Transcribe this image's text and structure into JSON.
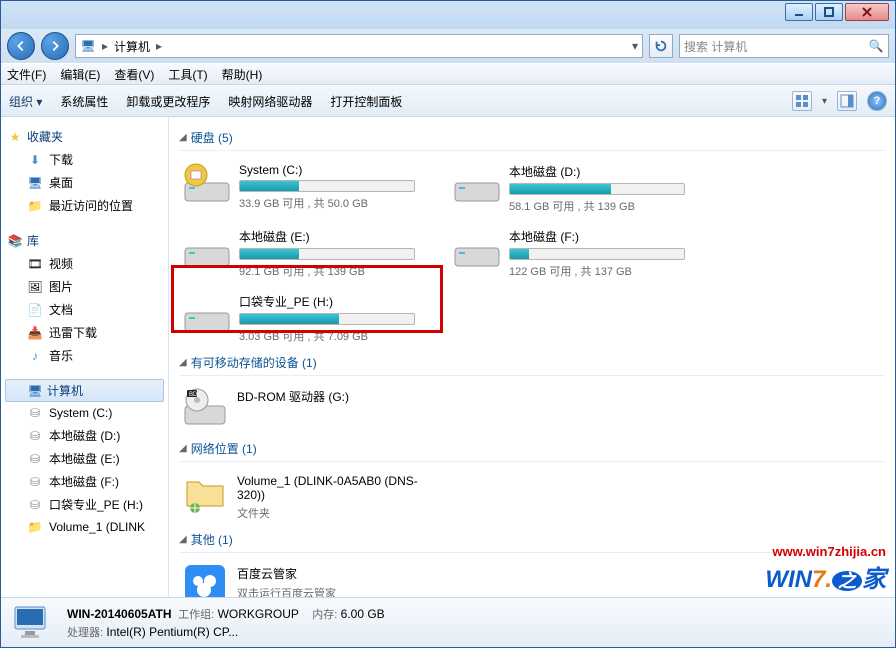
{
  "titlebar": {
    "minimize": "_",
    "maximize": "☐",
    "close": "×"
  },
  "nav": {
    "breadcrumb_icon": "computer",
    "breadcrumb": "计算机",
    "search_placeholder": "搜索 计算机"
  },
  "menu": {
    "file": "文件(F)",
    "edit": "编辑(E)",
    "view": "查看(V)",
    "tools": "工具(T)",
    "help": "帮助(H)"
  },
  "toolbar": {
    "organize": "组织 ▾",
    "sysprop": "系统属性",
    "uninstall": "卸载或更改程序",
    "mapnet": "映射网络驱动器",
    "ctrlpanel": "打开控制面板"
  },
  "side": {
    "favorites": "收藏夹",
    "fav_items": [
      "下载",
      "桌面",
      "最近访问的位置"
    ],
    "libraries": "库",
    "lib_items": [
      "视频",
      "图片",
      "文档",
      "迅雷下载",
      "音乐"
    ],
    "computer": "计算机",
    "comp_items": [
      "System (C:)",
      "本地磁盘 (D:)",
      "本地磁盘 (E:)",
      "本地磁盘 (F:)",
      "口袋专业_PE (H:)",
      "Volume_1 (DLINK"
    ]
  },
  "main": {
    "hdd_header": "硬盘 (5)",
    "removable_header": "有可移动存储的设备 (1)",
    "network_header": "网络位置 (1)",
    "other_header": "其他 (1)",
    "drives": [
      {
        "name": "System (C:)",
        "free": "33.9 GB 可用 , 共 50.0 GB",
        "fill": 34
      },
      {
        "name": "本地磁盘 (D:)",
        "free": "58.1 GB 可用 , 共 139 GB",
        "fill": 58
      },
      {
        "name": "本地磁盘 (E:)",
        "free": "92.1 GB 可用 , 共 139 GB",
        "fill": 34
      },
      {
        "name": "本地磁盘 (F:)",
        "free": "122 GB 可用 , 共 137 GB",
        "fill": 11
      },
      {
        "name": "口袋专业_PE (H:)",
        "free": "3.03 GB 可用 , 共 7.09 GB",
        "fill": 57
      }
    ],
    "removable": {
      "name": "BD-ROM 驱动器 (G:)"
    },
    "network": {
      "name": "Volume_1 (DLINK-0A5AB0 (DNS-320))",
      "sub": "文件夹"
    },
    "other": {
      "name": "百度云管家",
      "sub": "双击运行百度云管家"
    }
  },
  "status": {
    "host": "WIN-20140605ATH",
    "wg_label": "工作组:",
    "wg": "WORKGROUP",
    "cpu_label": "处理器:",
    "cpu": "Intel(R) Pentium(R) CP...",
    "mem_label": "内存:",
    "mem": "6.00 GB"
  },
  "watermark": {
    "l1": "www.win7zhijia.cn",
    "l2a": "WIN",
    "l2b": "7.",
    "l2c": "家"
  }
}
